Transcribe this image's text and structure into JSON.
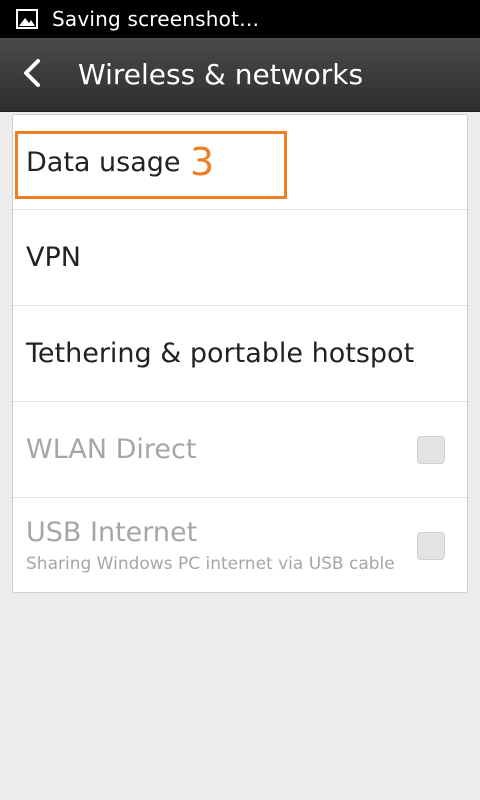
{
  "status_bar": {
    "icon": "image-icon",
    "text": "Saving screenshot…"
  },
  "action_bar": {
    "back_icon": "chevron-left-icon",
    "title": "Wireless & networks"
  },
  "settings": [
    {
      "label": "Data usage",
      "enabled": true
    },
    {
      "label": "VPN",
      "enabled": true
    },
    {
      "label": "Tethering & portable hotspot",
      "enabled": true
    },
    {
      "label": "WLAN Direct",
      "enabled": false,
      "checked": false
    },
    {
      "label": "USB Internet",
      "subtitle": "Sharing Windows PC internet via USB cable",
      "enabled": false,
      "checked": false
    }
  ],
  "annotation": {
    "number": "3",
    "color": "#f07f24"
  }
}
